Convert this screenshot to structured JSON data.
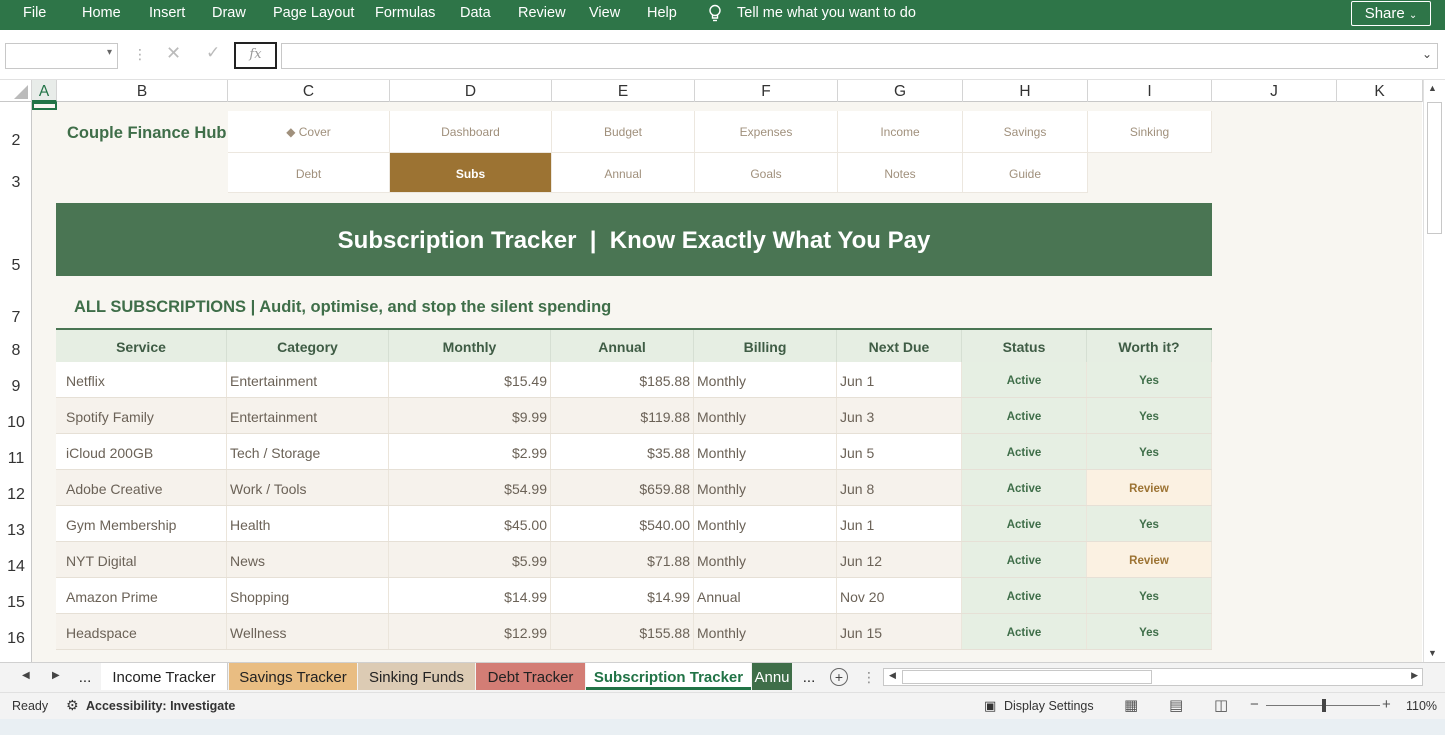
{
  "ribbon": {
    "menus": [
      "File",
      "Home",
      "Insert",
      "Draw",
      "Page Layout",
      "Formulas",
      "Data",
      "Review",
      "View",
      "Help"
    ],
    "tell_me": "Tell me what you want to do",
    "share": "Share"
  },
  "formula_bar": {
    "name_box": "",
    "fx": "fx",
    "formula": ""
  },
  "columns": [
    "A",
    "B",
    "C",
    "D",
    "E",
    "F",
    "G",
    "H",
    "I",
    "J",
    "K"
  ],
  "rows": [
    "2",
    "3",
    "5",
    "7",
    "8",
    "9",
    "10",
    "11",
    "12",
    "13",
    "14",
    "15",
    "16"
  ],
  "brand": "Couple Finance Hub",
  "nav": {
    "row1": [
      "◆ Cover",
      "Dashboard",
      "Budget",
      "Expenses",
      "Income",
      "Savings",
      "Sinking"
    ],
    "row2": [
      "Debt",
      "Subs",
      "Annual",
      "Goals",
      "Notes",
      "Guide"
    ]
  },
  "banner": "Subscription Tracker  |  Know Exactly What You Pay",
  "section": "ALL SUBSCRIPTIONS  |  Audit, optimise, and stop the silent spending",
  "table": {
    "headers": [
      "Service",
      "Category",
      "Monthly",
      "Annual",
      "Billing",
      "Next Due",
      "Status",
      "Worth it?"
    ],
    "rows": [
      [
        "Netflix",
        "Entertainment",
        "$15.49",
        "$185.88",
        "Monthly",
        "Jun 1",
        "Active",
        "Yes"
      ],
      [
        "Spotify Family",
        "Entertainment",
        "$9.99",
        "$119.88",
        "Monthly",
        "Jun 3",
        "Active",
        "Yes"
      ],
      [
        "iCloud 200GB",
        "Tech / Storage",
        "$2.99",
        "$35.88",
        "Monthly",
        "Jun 5",
        "Active",
        "Yes"
      ],
      [
        "Adobe Creative",
        "Work / Tools",
        "$54.99",
        "$659.88",
        "Monthly",
        "Jun 8",
        "Active",
        "Review"
      ],
      [
        "Gym Membership",
        "Health",
        "$45.00",
        "$540.00",
        "Monthly",
        "Jun 1",
        "Active",
        "Yes"
      ],
      [
        "NYT Digital",
        "News",
        "$5.99",
        "$71.88",
        "Monthly",
        "Jun 12",
        "Active",
        "Review"
      ],
      [
        "Amazon Prime",
        "Shopping",
        "$14.99",
        "$14.99",
        "Annual",
        "Nov 20",
        "Active",
        "Yes"
      ],
      [
        "Headspace",
        "Wellness",
        "$12.99",
        "$155.88",
        "Monthly",
        "Jun 15",
        "Active",
        "Yes"
      ]
    ]
  },
  "sheet_tabs": [
    "...",
    "Income Tracker",
    "Savings Tracker",
    "Sinking Funds",
    "Debt Tracker",
    "Subscription Tracker",
    "Annu",
    "..."
  ],
  "status": {
    "ready": "Ready",
    "accessibility": "Accessibility: Investigate",
    "display": "Display Settings",
    "zoom": "110%"
  },
  "colors": {
    "ribbon": "#2e7548",
    "banner": "#4a7553",
    "active_nav": "#9c7333",
    "accent_green": "#3f6e49"
  }
}
